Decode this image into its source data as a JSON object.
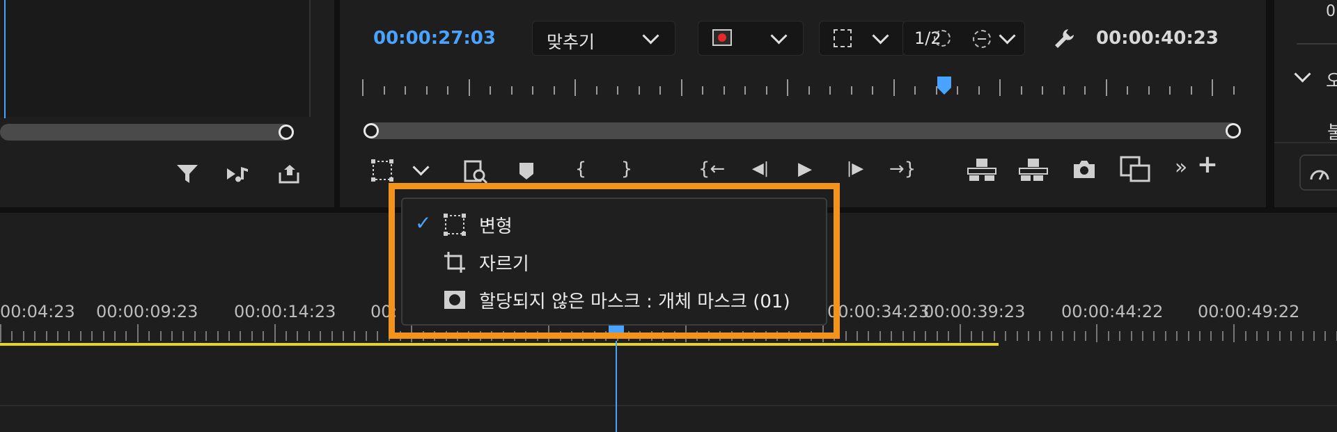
{
  "program_monitor": {
    "current_timecode": "00:00:27:03",
    "duration_timecode": "00:00:40:23",
    "zoom_select": "맞추기",
    "resolution": "1/2",
    "accent": "#4aa3ff"
  },
  "source_monitor": {
    "icons": [
      "filter-icon",
      "insert-audio-icon",
      "export-icon"
    ]
  },
  "controls": {
    "transport_glyphs": {
      "mark_in": "{",
      "mark_out": "}",
      "go_to_in": "{←",
      "step_back": "◀|",
      "play": "▶",
      "step_forward": "|▶",
      "go_to_out": "→}",
      "more": "»",
      "add": "+"
    }
  },
  "overlay_menu": {
    "items": [
      {
        "label": "변형",
        "checked": true,
        "icon": "transform-icon"
      },
      {
        "label": "자르기",
        "checked": false,
        "icon": "crop-icon"
      },
      {
        "label": "할당되지 않은 마스크 : 개체 마스크 (01)",
        "checked": false,
        "icon": "mask-icon"
      }
    ],
    "check_glyph": "✓",
    "highlight_color": "#f2941c"
  },
  "timeline": {
    "ruler_labels": [
      "00:04:23",
      "00:00:09:23",
      "00:00:14:23",
      "00:",
      "00:00:34:23",
      "00:00:39:23",
      "00:00:44:22",
      "00:00:49:22"
    ],
    "work_area_color": "#e8d51b"
  },
  "right_panel": {
    "partial_texts": [
      "0",
      "오",
      "불"
    ]
  }
}
